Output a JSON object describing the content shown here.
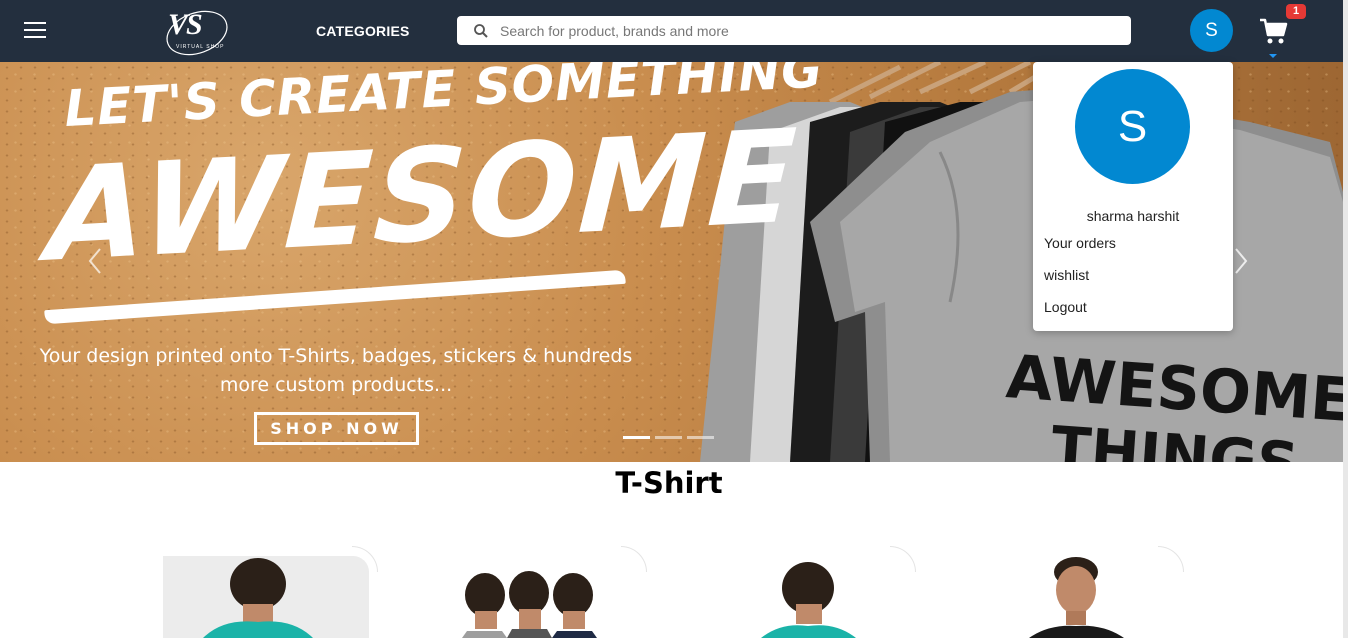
{
  "header": {
    "logo_text": "VS",
    "logo_sub": "VIRTUAL   SHOP",
    "categories_label": "CATEGORIES",
    "search_placeholder": "Search for product, brands and more",
    "avatar_initial": "S",
    "cart_count": "1",
    "icons": [
      "menu-icon",
      "search-icon",
      "cart-icon"
    ]
  },
  "hero": {
    "line1": "LET'S CREATE SOMETHING",
    "line2": "AWESOME",
    "subtitle": "Your design printed onto T-Shirts, badges, stickers & hundreds more custom products...",
    "button": "SHOP NOW",
    "shirt_text_1": "AWESOME",
    "shirt_text_2": "THINGS",
    "slides": 3,
    "active_slide": 1
  },
  "dropdown": {
    "avatar_initial": "S",
    "user_name": "sharma harshit",
    "items": [
      "Your orders",
      "wishlist",
      "Logout"
    ]
  },
  "section": {
    "title": "T-Shirt"
  },
  "colors": {
    "header_bg": "#232f3e",
    "avatar": "#0288d1",
    "badge": "#e53935"
  }
}
